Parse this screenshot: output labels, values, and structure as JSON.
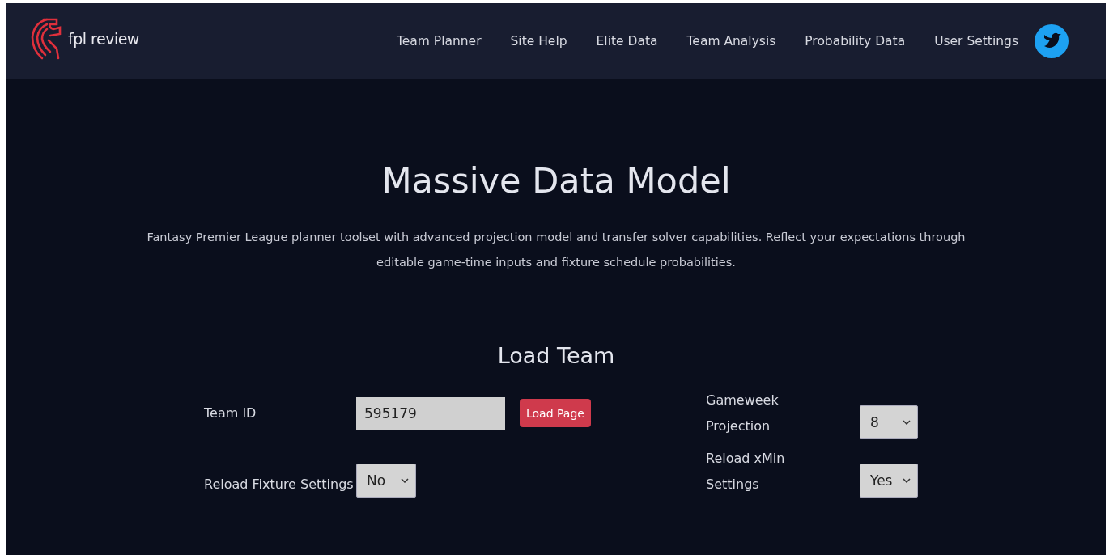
{
  "header": {
    "brand": "fpl review",
    "nav": [
      {
        "label": "Team Planner"
      },
      {
        "label": "Site Help"
      },
      {
        "label": "Elite Data"
      },
      {
        "label": "Team Analysis"
      },
      {
        "label": "Probability Data"
      },
      {
        "label": "User Settings"
      }
    ]
  },
  "hero": {
    "title": "Massive Data Model",
    "description": "Fantasy Premier League planner toolset with advanced projection model and transfer solver capabilities. Reflect your expectations through editable game-time inputs and fixture schedule probabilities."
  },
  "load_team": {
    "title": "Load Team",
    "team_id": {
      "label": "Team ID",
      "value": "595179"
    },
    "load_button": "Load Page",
    "reload_fixture": {
      "label": "Reload Fixture Settings",
      "value": "No"
    },
    "gameweek": {
      "label": "Gameweek Projection",
      "value": "8"
    },
    "reload_xmin": {
      "label": "Reload xMin Settings",
      "value": "Yes"
    }
  }
}
